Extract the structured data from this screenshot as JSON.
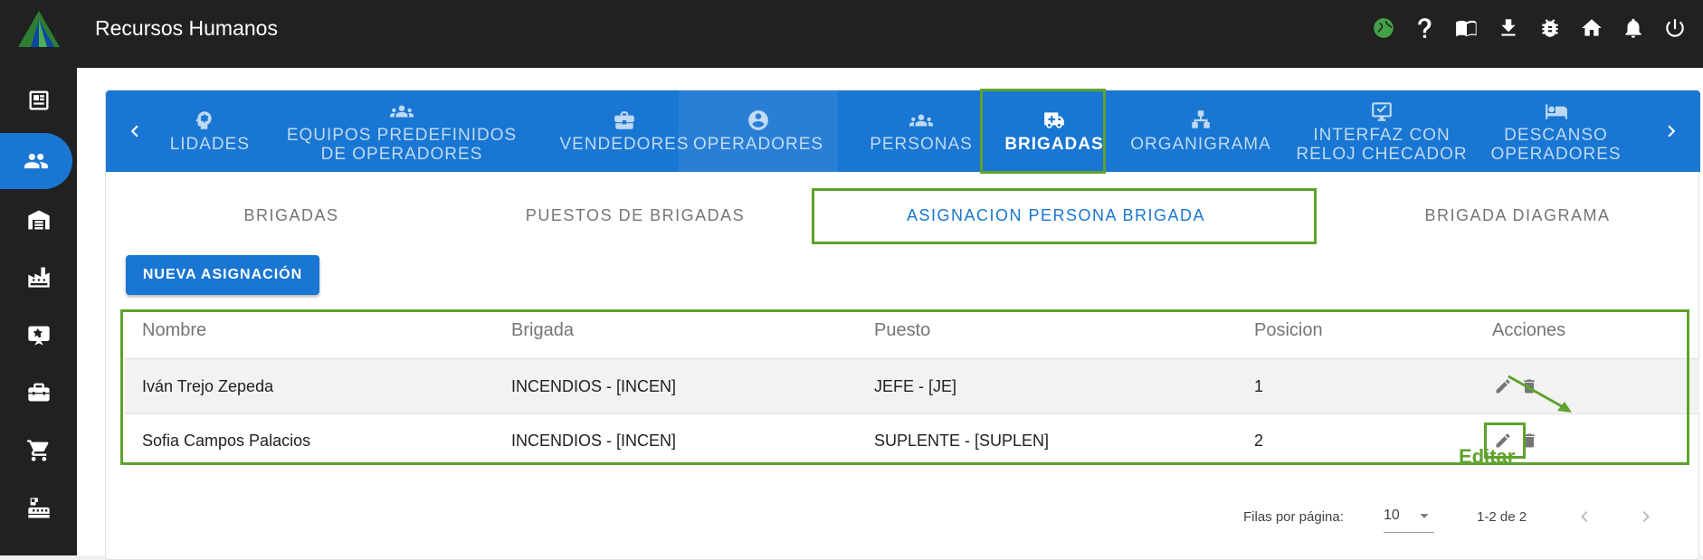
{
  "app": {
    "title": "Recursos Humanos"
  },
  "topbar_icons": [
    "globe-icon",
    "help-icon",
    "book-icon",
    "download-icon",
    "bug-icon",
    "home-icon",
    "bell-icon",
    "power-icon"
  ],
  "sidebar": {
    "items": [
      "news-icon",
      "people-icon",
      "warehouse-icon",
      "factory-icon",
      "badge-icon",
      "toolbox-icon",
      "cart-icon",
      "cash-register-icon"
    ],
    "active_index": 1
  },
  "main_tabs": [
    {
      "label": "LIDADES",
      "icon": "brain-icon"
    },
    {
      "label": "EQUIPOS PREDEFINIDOS DE OPERADORES",
      "line1": "EQUIPOS PREDEFINIDOS",
      "line2": "DE OPERADORES",
      "icon": "group-icon"
    },
    {
      "label": "VENDEDORES",
      "icon": "briefcase-icon"
    },
    {
      "label": "OPERADORES",
      "icon": "account-circle-icon"
    },
    {
      "label": "PERSONAS",
      "icon": "group-icon"
    },
    {
      "label": "BRIGADAS",
      "icon": "ambulance-icon"
    },
    {
      "label": "ORGANIGRAMA",
      "icon": "sitemap-icon"
    },
    {
      "label": "INTERFAZ CON RELOJ CHECADOR",
      "line1": "INTERFAZ CON",
      "line2": "RELOJ CHECADOR",
      "icon": "monitor-check-icon"
    },
    {
      "label": "DESCANSO OPERADORES",
      "line1": "DESCANSO",
      "line2": "OPERADORES",
      "icon": "bed-icon"
    }
  ],
  "active_main_tab": "BRIGADAS",
  "sub_tabs": [
    "BRIGADAS",
    "PUESTOS DE BRIGADAS",
    "ASIGNACION PERSONA BRIGADA",
    "BRIGADA DIAGRAMA"
  ],
  "active_sub_tab": "ASIGNACION PERSONA BRIGADA",
  "new_button": "NUEVA ASIGNACIÓN",
  "table": {
    "columns": [
      "Nombre",
      "Brigada",
      "Puesto",
      "Posicion",
      "Acciones"
    ],
    "rows": [
      {
        "nombre": "Iván Trejo Zepeda",
        "brigada": "INCENDIOS - [INCEN]",
        "puesto": "JEFE - [JE]",
        "posicion": "1"
      },
      {
        "nombre": "Sofia Campos Palacios",
        "brigada": "INCENDIOS - [INCEN]",
        "puesto": "SUPLENTE - [SUPLEN]",
        "posicion": "2"
      }
    ]
  },
  "annotation": "Editar",
  "pagination": {
    "rows_label": "Filas por página:",
    "rows_per_page": "10",
    "range": "1-2 de 2"
  },
  "colors": {
    "primary": "#1976d2",
    "highlight": "#5fa22c",
    "topbar": "#212121"
  }
}
